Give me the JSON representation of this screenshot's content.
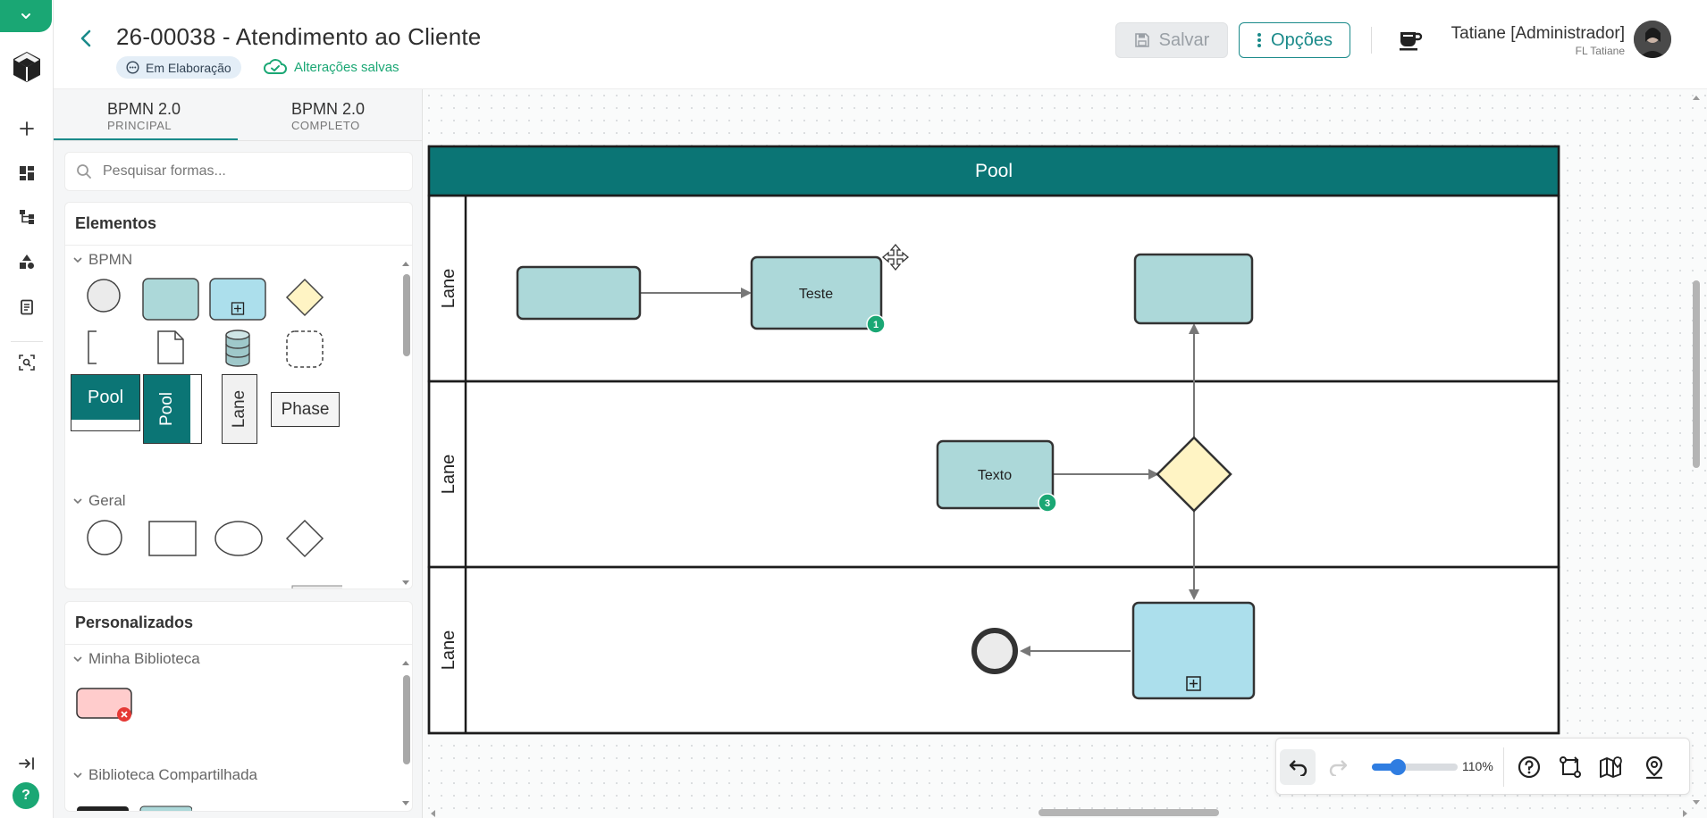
{
  "header": {
    "title": "26-00038 - Atendimento ao Cliente",
    "status_badge": "Em Elaboração",
    "saved_status": "Alterações salvas",
    "save_label": "Salvar",
    "options_label": "Opções",
    "user_name": "Tatiane [Administrador]",
    "user_org": "FL Tatiane"
  },
  "panel": {
    "tabs": [
      {
        "label": "BPMN 2.0",
        "sublabel": "PRINCIPAL",
        "active": true
      },
      {
        "label": "BPMN 2.0",
        "sublabel": "COMPLETO",
        "active": false
      }
    ],
    "search_placeholder": "Pesquisar formas...",
    "elements_title": "Elementos",
    "bpmn_group": "BPMN",
    "general_group": "Geral",
    "shape_labels": {
      "pool": "Pool",
      "pool_vertical": "Pool",
      "lane": "Lane",
      "phase": "Phase"
    },
    "custom_title": "Personalizados",
    "my_library": "Minha Biblioteca",
    "shared_library": "Biblioteca Compartilhada"
  },
  "diagram": {
    "pool_label": "Pool",
    "lane_labels": [
      "Lane",
      "Lane",
      "Lane"
    ],
    "task_teste": "Teste",
    "task_teste_badge": "1",
    "task_texto": "Texto",
    "task_texto_badge": "3"
  },
  "toolbar": {
    "zoom_label": "110%",
    "zoom_level": 0.3
  },
  "colors": {
    "brand_green": "#1aa774",
    "teal": "#0b7575",
    "task_fill": "#acd8d9",
    "subprocess_fill": "#acdfec",
    "gateway_fill": "#fff4c4"
  }
}
